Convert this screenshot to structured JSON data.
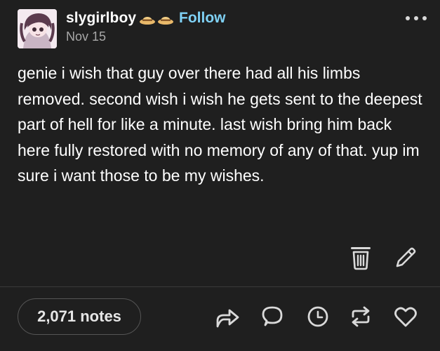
{
  "post": {
    "blog_name": "slygirlboy",
    "badges": [
      "hat-badge-icon",
      "hat-badge-icon"
    ],
    "follow_label": "Follow",
    "date": "Nov 15",
    "body": "genie i wish that guy over there had all his limbs removed. second wish i wish he gets sent to the deepest part of hell for like a minute. last wish bring him back here fully restored with no memory of any of that. yup im sure i want those to be my wishes.",
    "notes_label": "2,071 notes"
  },
  "colors": {
    "background": "#1f1f1f",
    "text": "#ffffff",
    "follow_accent": "#7fd1f5",
    "secondary_text": "#a8a8a8",
    "icon": "#d9d9d9"
  },
  "icons": {
    "more": "more-dots-icon",
    "delete": "trash-icon",
    "edit": "pencil-icon",
    "share": "share-arrow-icon",
    "reply": "reply-bubble-icon",
    "queue": "clock-icon",
    "reblog": "reblog-icon",
    "like": "heart-icon"
  }
}
